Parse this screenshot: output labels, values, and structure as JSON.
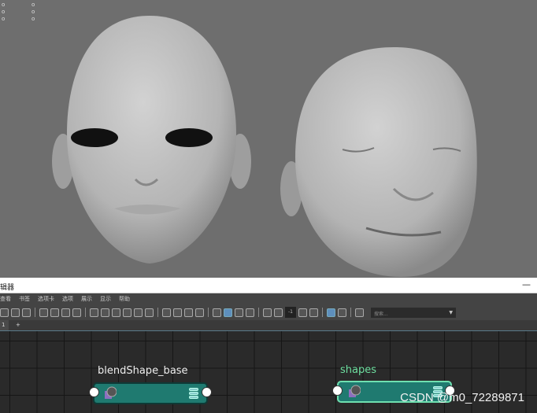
{
  "viewport": {
    "hud_left": [
      "o",
      "o",
      "o"
    ],
    "hud_right": [
      "o",
      "o",
      "o"
    ]
  },
  "window": {
    "title": "辑器",
    "minimize": "—"
  },
  "menu": [
    "查看",
    "书签",
    "选项卡",
    "选项",
    "展示",
    "显示",
    "帮助"
  ],
  "toolbar": {
    "num_field": "-1",
    "search_placeholder": "搜索...",
    "dropdown": "▼"
  },
  "tabs": {
    "current": "1",
    "add": "+"
  },
  "nodes": [
    {
      "name": "blendShape_base",
      "selected": false
    },
    {
      "name": "shapes",
      "selected": true
    }
  ],
  "watermark": "CSDN @m0_72289871",
  "colors": {
    "node": "#1f7a70",
    "selected_outline": "#6ee0b0",
    "accent": "#5e8fbd"
  }
}
